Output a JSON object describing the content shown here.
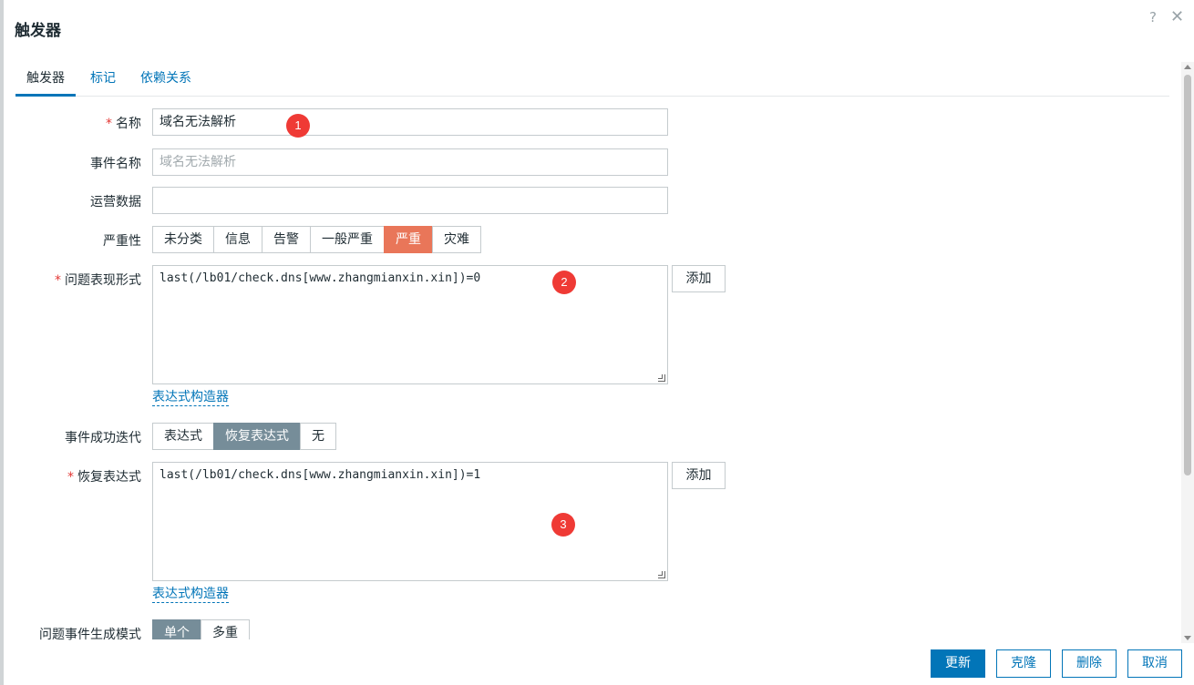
{
  "dialog": {
    "title": "触发器",
    "help_icon": "?",
    "close_icon": "✕"
  },
  "tabs": [
    {
      "label": "触发器",
      "active": true
    },
    {
      "label": "标记",
      "active": false
    },
    {
      "label": "依赖关系",
      "active": false
    }
  ],
  "form": {
    "name": {
      "label": "名称",
      "value": "域名无法解析"
    },
    "event_name": {
      "label": "事件名称",
      "placeholder": "域名无法解析"
    },
    "opdata": {
      "label": "运营数据",
      "value": ""
    },
    "severity": {
      "label": "严重性",
      "options": [
        "未分类",
        "信息",
        "告警",
        "一般严重",
        "严重",
        "灾难"
      ],
      "selected": "严重"
    },
    "problem_expression": {
      "label": "问题表现形式",
      "value": "last(/lb01/check.dns[www.zhangmianxin.xin])=0",
      "add_label": "添加",
      "builder_link": "表达式构造器"
    },
    "ok_event_generation": {
      "label": "事件成功迭代",
      "options": [
        "表达式",
        "恢复表达式",
        "无"
      ],
      "selected": "恢复表达式"
    },
    "recovery_expression": {
      "label": "恢复表达式",
      "value": "last(/lb01/check.dns[www.zhangmianxin.xin])=1",
      "add_label": "添加",
      "builder_link": "表达式构造器"
    },
    "problem_event_mode": {
      "label": "问题事件生成模式",
      "options": [
        "单个",
        "多重"
      ],
      "selected": "单个"
    }
  },
  "annotations": [
    "1",
    "2",
    "3"
  ],
  "footer": {
    "update": "更新",
    "clone": "克隆",
    "delete": "删除",
    "cancel": "取消"
  },
  "colors": {
    "accent": "#0275b8",
    "severity_high": "#e97659",
    "segment_selected": "#768d99",
    "badge": "#ef3a35"
  }
}
